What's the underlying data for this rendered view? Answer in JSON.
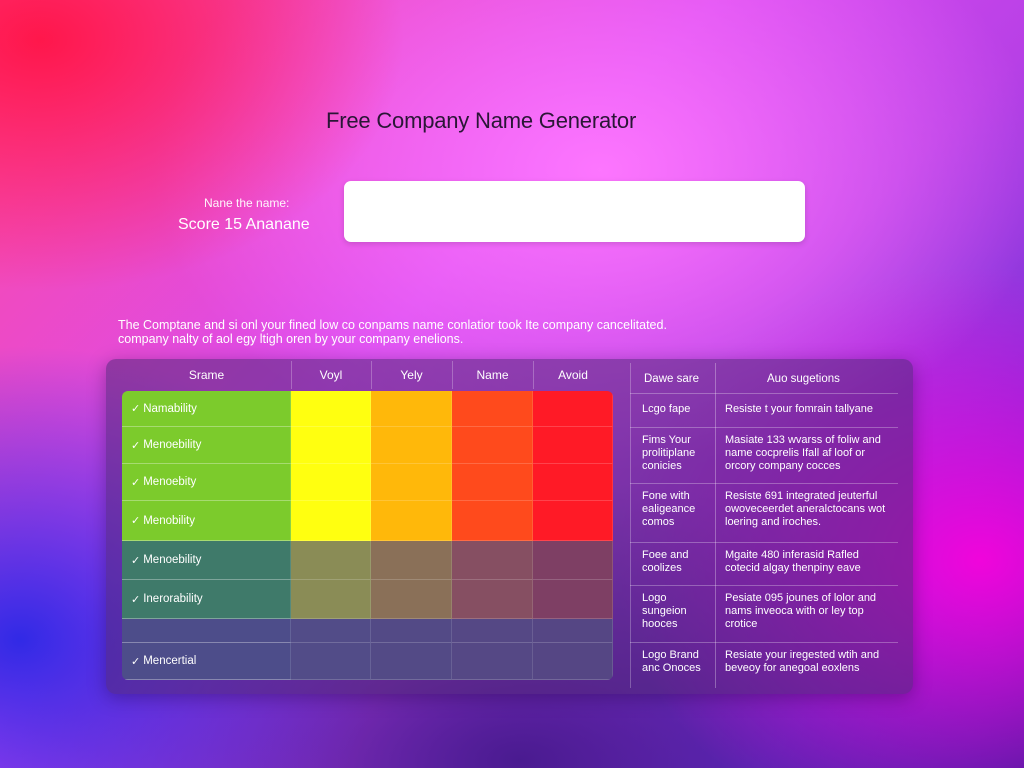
{
  "header": {
    "title": "Free Company Name Generator"
  },
  "form": {
    "name_label": "Nane the name:",
    "score_label": "Score 15 Ananane",
    "input_value": "",
    "input_placeholder": ""
  },
  "description": {
    "line1": "The Comptane and si onl your fined low co conpams name conlatior took Ite company cancelitated.",
    "line2": "company nalty of aol egy ltigh oren by your company enelions."
  },
  "grid": {
    "headers": [
      "Srame",
      "Voyl",
      "Yely",
      "Name",
      "Avoid"
    ],
    "rows": [
      {
        "label": "Namability",
        "checked": true
      },
      {
        "label": "Menoebility",
        "checked": true
      },
      {
        "label": "Menoebity",
        "checked": true
      },
      {
        "label": "Menobility",
        "checked": true
      },
      {
        "label": "Menoebility",
        "checked": true
      },
      {
        "label": "Inerorability",
        "checked": true
      },
      {
        "label": "",
        "checked": false
      },
      {
        "label": "Mencertial",
        "checked": true
      }
    ],
    "colors": {
      "bright": [
        "#7ccb2c",
        "#ffff10",
        "#ffb80a",
        "#ff4a1c",
        "#ff1a26"
      ],
      "dim": [
        "#3f7a6a",
        "#8a8c56",
        "#8a7058",
        "#864f62",
        "#7e3f64"
      ],
      "empty": [
        "#4d4d8a",
        "#524c88",
        "#534a86",
        "#554885",
        "#554684"
      ]
    }
  },
  "suggestions": {
    "headers": [
      "Dawe sare",
      "Auo sugetions"
    ],
    "rows": [
      {
        "name": "Lcgo fape",
        "suggestion": "Resiste t your fomrain tallyane"
      },
      {
        "name": "Fims Your prolitiplane conicies",
        "suggestion": "Masiate 133 wvarss of foliw and name cocprelis Ifall af loof or orcory company cocces"
      },
      {
        "name": "Fone with ealigeance comos",
        "suggestion": "Resiste 691 integrated jeuterful owoveceerdet aneralctocans wot loering and iroches."
      },
      {
        "name": "Foee and coolizes",
        "suggestion": "Mgaite 480 inferasid Rafled cotecid algay thenpiny eave"
      },
      {
        "name": "Logo sungeion hooces",
        "suggestion": "Pesiate 095 jounes of lolor and nams inveoca with or ley top crotice"
      },
      {
        "name": "Logo Brand anc Onoces",
        "suggestion": "Resiate your iregested wtih and beveoy for anegoal eoxlens"
      }
    ]
  }
}
